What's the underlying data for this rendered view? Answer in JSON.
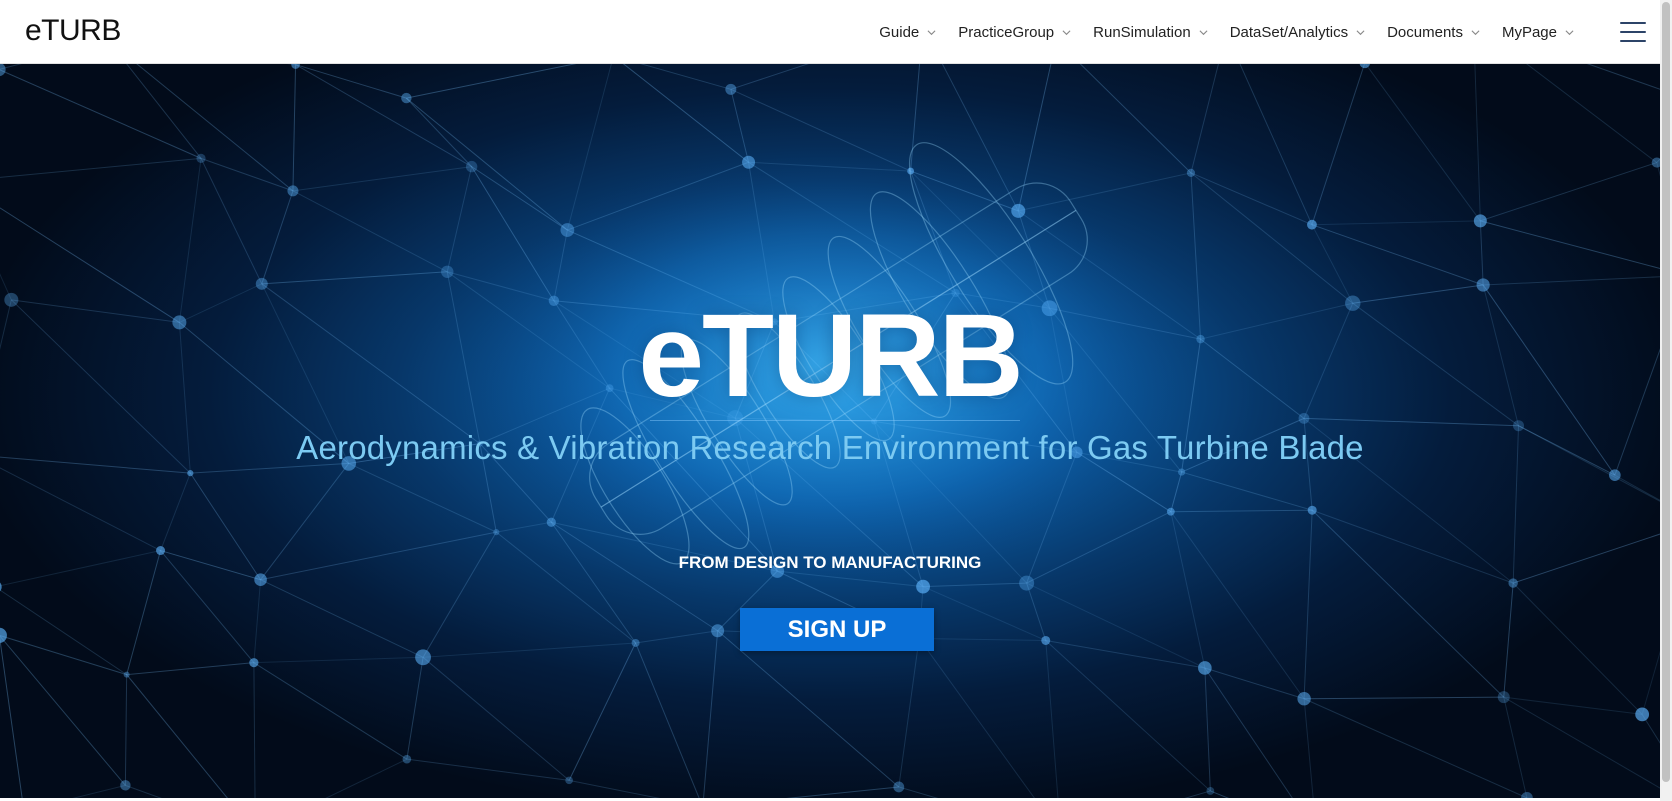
{
  "header": {
    "logo": "eTURB",
    "nav": [
      {
        "label": "Guide"
      },
      {
        "label": "PracticeGroup"
      },
      {
        "label": "RunSimulation"
      },
      {
        "label": "DataSet/Analytics"
      },
      {
        "label": "Documents"
      },
      {
        "label": "MyPage"
      }
    ],
    "menu_icon": "hamburger-icon"
  },
  "hero": {
    "title": "eTURB",
    "subtitle": "Aerodynamics & Vibration Research Environment for Gas Turbine Blade",
    "tagline": "FROM DESIGN TO MANUFACTURING",
    "cta_label": "SIGN UP"
  },
  "colors": {
    "cta_background": "#0a6fd6",
    "subtitle": "#7ccaf2",
    "hero_glow": "#1d8fd8",
    "hero_dark": "#020b1a"
  }
}
